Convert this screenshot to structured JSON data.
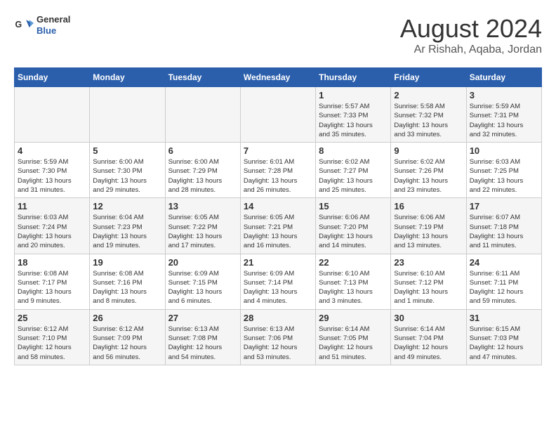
{
  "header": {
    "logo": {
      "general": "General",
      "blue": "Blue"
    },
    "title": "August 2024",
    "subtitle": "Ar Rishah, Aqaba, Jordan"
  },
  "days_of_week": [
    "Sunday",
    "Monday",
    "Tuesday",
    "Wednesday",
    "Thursday",
    "Friday",
    "Saturday"
  ],
  "weeks": [
    [
      {
        "day": "",
        "info": ""
      },
      {
        "day": "",
        "info": ""
      },
      {
        "day": "",
        "info": ""
      },
      {
        "day": "",
        "info": ""
      },
      {
        "day": "1",
        "info": "Sunrise: 5:57 AM\nSunset: 7:33 PM\nDaylight: 13 hours\nand 35 minutes."
      },
      {
        "day": "2",
        "info": "Sunrise: 5:58 AM\nSunset: 7:32 PM\nDaylight: 13 hours\nand 33 minutes."
      },
      {
        "day": "3",
        "info": "Sunrise: 5:59 AM\nSunset: 7:31 PM\nDaylight: 13 hours\nand 32 minutes."
      }
    ],
    [
      {
        "day": "4",
        "info": "Sunrise: 5:59 AM\nSunset: 7:30 PM\nDaylight: 13 hours\nand 31 minutes."
      },
      {
        "day": "5",
        "info": "Sunrise: 6:00 AM\nSunset: 7:30 PM\nDaylight: 13 hours\nand 29 minutes."
      },
      {
        "day": "6",
        "info": "Sunrise: 6:00 AM\nSunset: 7:29 PM\nDaylight: 13 hours\nand 28 minutes."
      },
      {
        "day": "7",
        "info": "Sunrise: 6:01 AM\nSunset: 7:28 PM\nDaylight: 13 hours\nand 26 minutes."
      },
      {
        "day": "8",
        "info": "Sunrise: 6:02 AM\nSunset: 7:27 PM\nDaylight: 13 hours\nand 25 minutes."
      },
      {
        "day": "9",
        "info": "Sunrise: 6:02 AM\nSunset: 7:26 PM\nDaylight: 13 hours\nand 23 minutes."
      },
      {
        "day": "10",
        "info": "Sunrise: 6:03 AM\nSunset: 7:25 PM\nDaylight: 13 hours\nand 22 minutes."
      }
    ],
    [
      {
        "day": "11",
        "info": "Sunrise: 6:03 AM\nSunset: 7:24 PM\nDaylight: 13 hours\nand 20 minutes."
      },
      {
        "day": "12",
        "info": "Sunrise: 6:04 AM\nSunset: 7:23 PM\nDaylight: 13 hours\nand 19 minutes."
      },
      {
        "day": "13",
        "info": "Sunrise: 6:05 AM\nSunset: 7:22 PM\nDaylight: 13 hours\nand 17 minutes."
      },
      {
        "day": "14",
        "info": "Sunrise: 6:05 AM\nSunset: 7:21 PM\nDaylight: 13 hours\nand 16 minutes."
      },
      {
        "day": "15",
        "info": "Sunrise: 6:06 AM\nSunset: 7:20 PM\nDaylight: 13 hours\nand 14 minutes."
      },
      {
        "day": "16",
        "info": "Sunrise: 6:06 AM\nSunset: 7:19 PM\nDaylight: 13 hours\nand 13 minutes."
      },
      {
        "day": "17",
        "info": "Sunrise: 6:07 AM\nSunset: 7:18 PM\nDaylight: 13 hours\nand 11 minutes."
      }
    ],
    [
      {
        "day": "18",
        "info": "Sunrise: 6:08 AM\nSunset: 7:17 PM\nDaylight: 13 hours\nand 9 minutes."
      },
      {
        "day": "19",
        "info": "Sunrise: 6:08 AM\nSunset: 7:16 PM\nDaylight: 13 hours\nand 8 minutes."
      },
      {
        "day": "20",
        "info": "Sunrise: 6:09 AM\nSunset: 7:15 PM\nDaylight: 13 hours\nand 6 minutes."
      },
      {
        "day": "21",
        "info": "Sunrise: 6:09 AM\nSunset: 7:14 PM\nDaylight: 13 hours\nand 4 minutes."
      },
      {
        "day": "22",
        "info": "Sunrise: 6:10 AM\nSunset: 7:13 PM\nDaylight: 13 hours\nand 3 minutes."
      },
      {
        "day": "23",
        "info": "Sunrise: 6:10 AM\nSunset: 7:12 PM\nDaylight: 13 hours\nand 1 minute."
      },
      {
        "day": "24",
        "info": "Sunrise: 6:11 AM\nSunset: 7:11 PM\nDaylight: 12 hours\nand 59 minutes."
      }
    ],
    [
      {
        "day": "25",
        "info": "Sunrise: 6:12 AM\nSunset: 7:10 PM\nDaylight: 12 hours\nand 58 minutes."
      },
      {
        "day": "26",
        "info": "Sunrise: 6:12 AM\nSunset: 7:09 PM\nDaylight: 12 hours\nand 56 minutes."
      },
      {
        "day": "27",
        "info": "Sunrise: 6:13 AM\nSunset: 7:08 PM\nDaylight: 12 hours\nand 54 minutes."
      },
      {
        "day": "28",
        "info": "Sunrise: 6:13 AM\nSunset: 7:06 PM\nDaylight: 12 hours\nand 53 minutes."
      },
      {
        "day": "29",
        "info": "Sunrise: 6:14 AM\nSunset: 7:05 PM\nDaylight: 12 hours\nand 51 minutes."
      },
      {
        "day": "30",
        "info": "Sunrise: 6:14 AM\nSunset: 7:04 PM\nDaylight: 12 hours\nand 49 minutes."
      },
      {
        "day": "31",
        "info": "Sunrise: 6:15 AM\nSunset: 7:03 PM\nDaylight: 12 hours\nand 47 minutes."
      }
    ]
  ]
}
